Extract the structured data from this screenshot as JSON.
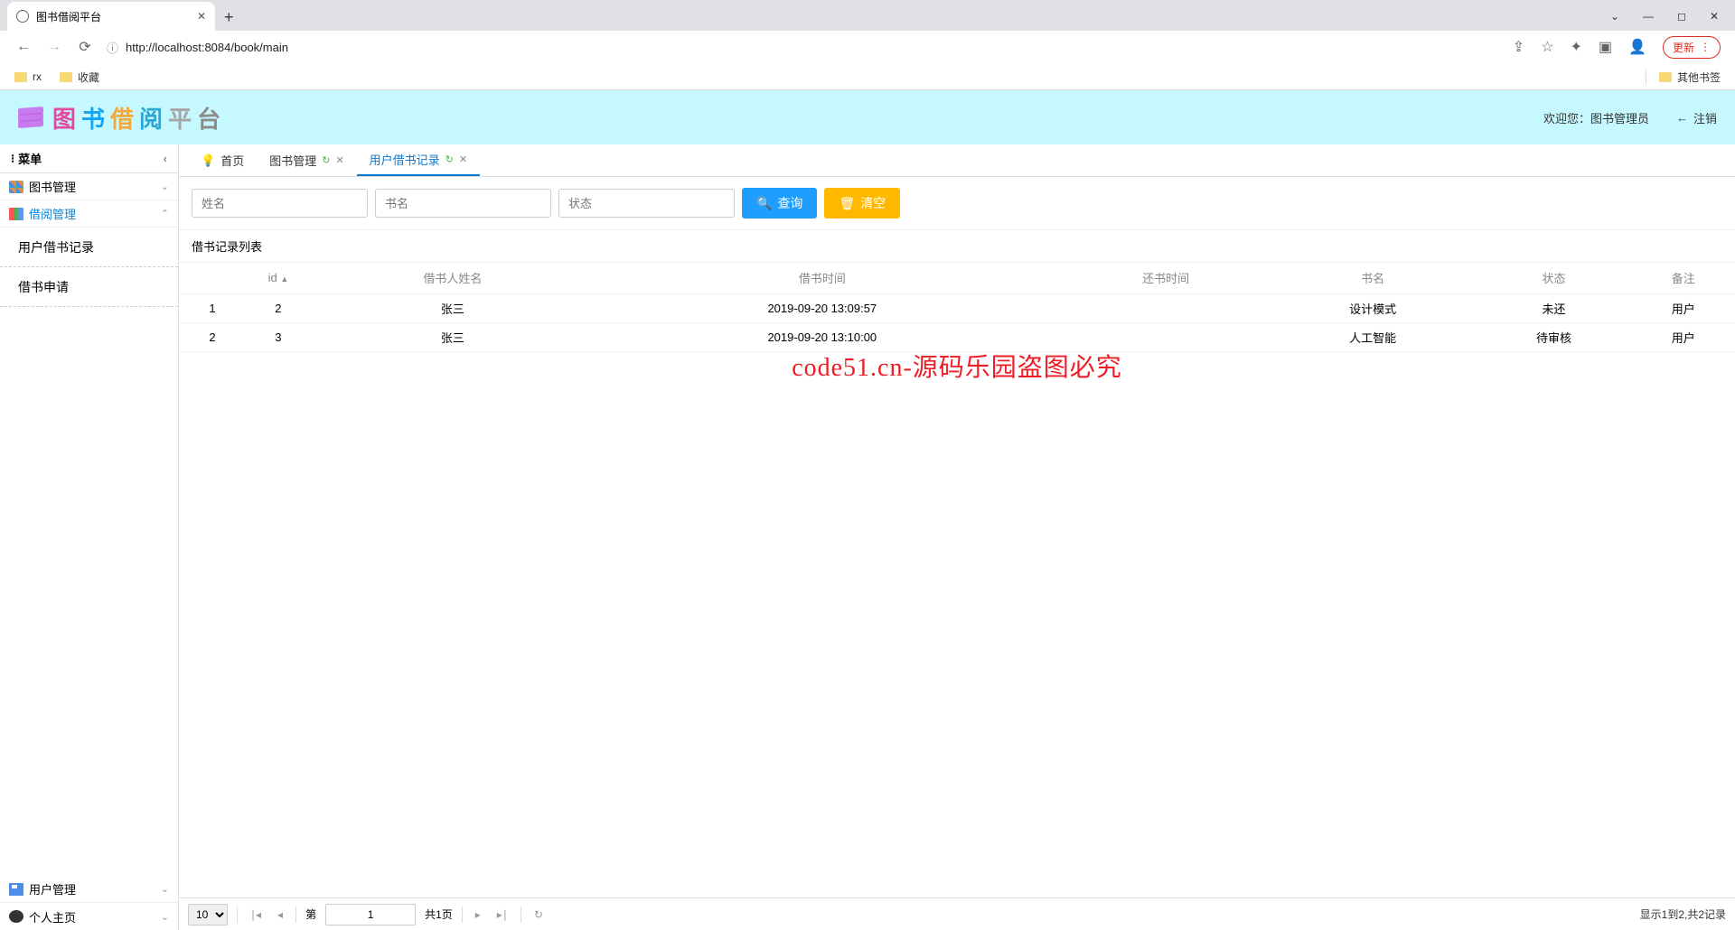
{
  "browser": {
    "tab_title": "图书借阅平台",
    "url_display": "http://localhost:8084/book/main",
    "update_label": "更新",
    "bookmarks": [
      "rx",
      "收藏"
    ],
    "other_bookmarks": "其他书签"
  },
  "header": {
    "title_chars": [
      "图",
      "书",
      "借",
      "阅",
      "平",
      "台"
    ],
    "welcome_prefix": "欢迎您：",
    "username": "图书管理员",
    "logout": "注销"
  },
  "sidebar": {
    "menu_header": "菜单",
    "book_mgmt": "图书管理",
    "borrow_mgmt": "借阅管理",
    "sub_records": "用户借书记录",
    "sub_apply": "借书申请",
    "user_mgmt": "用户管理",
    "personal": "个人主页"
  },
  "tabs": {
    "home": "首页",
    "book_mgmt": "图书管理",
    "records": "用户借书记录"
  },
  "filter": {
    "name_ph": "姓名",
    "book_ph": "书名",
    "state_ph": "状态",
    "search": "查询",
    "clear": "清空"
  },
  "panel_title": "借书记录列表",
  "columns": {
    "idx": "",
    "id": "id",
    "borrower": "借书人姓名",
    "borrow_time": "借书时间",
    "return_time": "还书时间",
    "book": "书名",
    "state": "状态",
    "remark": "备注"
  },
  "rows": [
    {
      "idx": "1",
      "id": "2",
      "borrower": "张三",
      "borrow_time": "2019-09-20 13:09:57",
      "return_time": "",
      "book": "设计模式",
      "state": "未还",
      "remark": "用户"
    },
    {
      "idx": "2",
      "id": "3",
      "borrower": "张三",
      "borrow_time": "2019-09-20 13:10:00",
      "return_time": "",
      "book": "人工智能",
      "state": "待审核",
      "remark": "用户"
    }
  ],
  "pager": {
    "page_size": "10",
    "page_label_prefix": "第",
    "page_no": "1",
    "total_pages": "共1页",
    "summary": "显示1到2,共2记录"
  },
  "watermark": "code51.cn-源码乐园盗图必究"
}
